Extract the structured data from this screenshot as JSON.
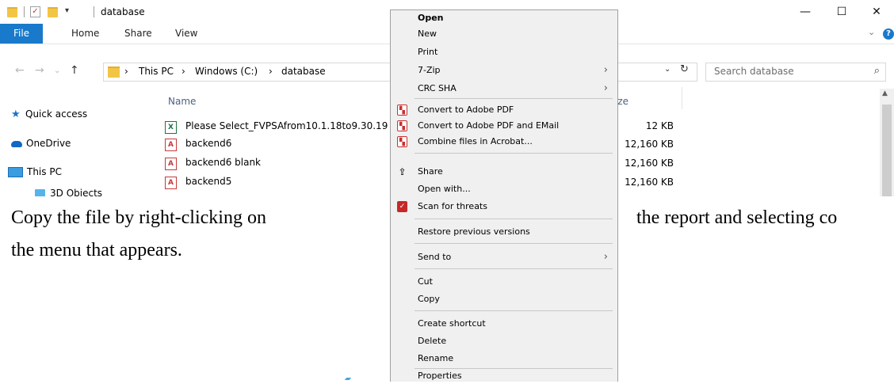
{
  "window": {
    "title": "database",
    "quick_access_dropdown": "▾",
    "controls": {
      "minimize": "—",
      "maximize": "☐",
      "close": "✕"
    }
  },
  "ribbon": {
    "tabs": [
      "File",
      "Home",
      "Share",
      "View"
    ],
    "expand": "⌄",
    "help": "?"
  },
  "addressbar": {
    "back": "←",
    "forward": "→",
    "recent": "⌄",
    "up": "↑",
    "sep": "›",
    "breadcrumb": [
      "This PC",
      "Windows (C:)",
      "database"
    ],
    "dropdown": "⌄",
    "refresh": "↻",
    "search_placeholder": "Search database",
    "search_icon": "⌕"
  },
  "navpane": {
    "items": [
      "Quick access",
      "OneDrive",
      "This PC",
      "3D Objects"
    ],
    "star": "★"
  },
  "file_list": {
    "name_header": "Name",
    "size_header": "ize",
    "files": [
      {
        "name": "Please Select_FVPSAfrom10.1.18to9.30.19",
        "size": "12 KB",
        "type": "xlsx",
        "icon_glyph": "X"
      },
      {
        "name": "backend6",
        "size": "12,160 KB",
        "type": "access",
        "icon_glyph": "A"
      },
      {
        "name": "backend6  blank",
        "size": "12,160 KB",
        "type": "access",
        "icon_glyph": "A"
      },
      {
        "name": "backend5",
        "size": "12,160 KB",
        "type": "access",
        "icon_glyph": "A"
      }
    ],
    "scroll_up": "▲"
  },
  "document": {
    "line1_left": "Copy the file by right-clicking on",
    "line1_right": "the report and selecting co",
    "line2": "the menu that appears."
  },
  "context_menu": {
    "items": [
      {
        "label": "Open",
        "bold": true
      },
      {
        "label": "New"
      },
      {
        "label": "Print"
      },
      {
        "label": "7-Zip",
        "submenu": true
      },
      {
        "label": "CRC SHA",
        "submenu": true
      },
      {
        "label": "Convert to Adobe PDF",
        "icon": "pdf-icon",
        "glyph": "▚"
      },
      {
        "label": "Convert to Adobe PDF and EMail",
        "icon": "pdf-email-icon",
        "glyph": "▚"
      },
      {
        "label": "Combine files in Acrobat...",
        "icon": "acrobat-combine-icon",
        "glyph": "▚"
      },
      {
        "label": "Share",
        "icon": "share-icon",
        "glyph": "⇪"
      },
      {
        "label": "Open with..."
      },
      {
        "label": "Scan for threats",
        "icon": "antivirus-shield-icon",
        "glyph": "✓"
      },
      {
        "label": "Restore previous versions"
      },
      {
        "label": "Send to",
        "submenu": true
      },
      {
        "label": "Cut"
      },
      {
        "label": "Copy"
      },
      {
        "label": "Create shortcut"
      },
      {
        "label": "Delete"
      },
      {
        "label": "Rename"
      },
      {
        "label": "Properties"
      }
    ],
    "submenu_arrow": "›"
  },
  "colors": {
    "ribbon_file_tab": "#1979ca",
    "header_text": "#4d6082",
    "folder": "#f2c545"
  }
}
